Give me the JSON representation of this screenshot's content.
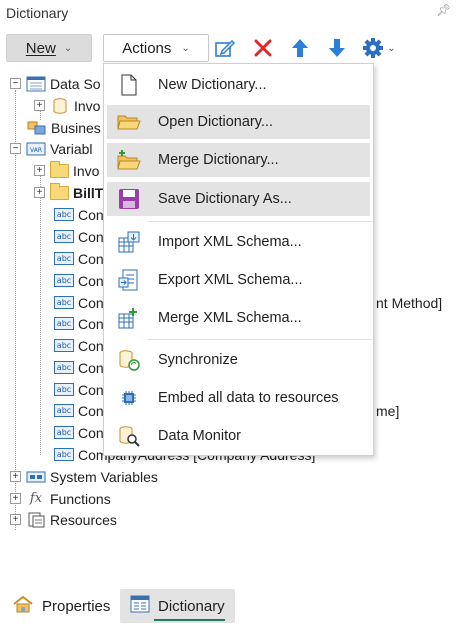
{
  "panel": {
    "title": "Dictionary"
  },
  "toolbar": {
    "new_label": "New",
    "actions_label": "Actions"
  },
  "tree": {
    "data_sources": "Data So",
    "invoice_ds": "Invo",
    "business_objects": "Busines",
    "variables": "Variabl",
    "invoice_var": "Invo",
    "bill_to": "BillT",
    "con_rows": [
      "Con",
      "Con",
      "Con",
      "Con",
      "Con",
      "Con",
      "Con",
      "Con",
      "Con",
      "Con",
      "Con"
    ],
    "payment_method_tail": "nt Method]",
    "name_tail": "me]",
    "company_address": "CompanyAddress [Company Address]",
    "system_variables": "System Variables",
    "functions": "Functions",
    "resources": "Resources"
  },
  "menu": {
    "items": [
      {
        "label": "New Dictionary...",
        "icon": "new-page-icon"
      },
      {
        "label": "Open Dictionary...",
        "icon": "open-folder-icon"
      },
      {
        "label": "Merge Dictionary...",
        "icon": "merge-folder-icon"
      },
      {
        "label": "Save Dictionary As...",
        "icon": "save-disk-icon"
      },
      {
        "label": "Import XML Schema...",
        "icon": "import-xml-icon"
      },
      {
        "label": "Export XML Schema...",
        "icon": "export-xml-icon"
      },
      {
        "label": "Merge XML Schema...",
        "icon": "merge-xml-icon"
      },
      {
        "label": "Synchronize",
        "icon": "synchronize-icon"
      },
      {
        "label": "Embed all data to resources",
        "icon": "embed-icon"
      },
      {
        "label": "Data Monitor",
        "icon": "data-monitor-icon"
      }
    ]
  },
  "tabs": [
    {
      "label": "Properties"
    },
    {
      "label": "Dictionary"
    }
  ],
  "colors": {
    "accent": "#1e7a63",
    "delete": "#e02828",
    "arrow": "#2b7fd9",
    "gear": "#2b6fc4"
  }
}
